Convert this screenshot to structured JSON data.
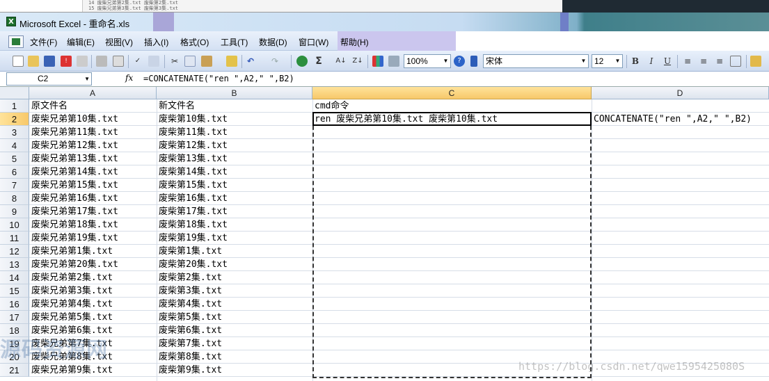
{
  "window": {
    "title": "Microsoft Excel - 重命名.xls",
    "app_icon": "excel-icon"
  },
  "background_window": {
    "lines": [
      "14  废柴兄弟第2集.txt       废柴第2集.txt",
      "15  废柴兄弟第3集.txt       废柴第3集.txt"
    ]
  },
  "menu": [
    "文件(F)",
    "编辑(E)",
    "视图(V)",
    "插入(I)",
    "格式(O)",
    "工具(T)",
    "数据(D)",
    "窗口(W)",
    "帮助(H)"
  ],
  "toolbar": {
    "zoom": "100%",
    "font_name": "宋体",
    "font_size": "12",
    "bold_label": "B",
    "italic_label": "I",
    "underline_label": "U"
  },
  "formula_bar": {
    "name_box": "C2",
    "fx_label": "fx",
    "formula": "=CONCATENATE(\"ren \",A2,\" \",B2)"
  },
  "columns": [
    "A",
    "B",
    "C",
    "D"
  ],
  "rows": [
    {
      "n": "1",
      "a": "原文件名",
      "b": "新文件名",
      "c": "cmd命令",
      "d": ""
    },
    {
      "n": "2",
      "a": "废柴兄弟第10集.txt",
      "b": "废柴第10集.txt",
      "c": "ren 废柴兄弟第10集.txt 废柴第10集.txt",
      "d": "CONCATENATE(\"ren \",A2,\" \",B2)"
    },
    {
      "n": "3",
      "a": "废柴兄弟第11集.txt",
      "b": "废柴第11集.txt",
      "c": "",
      "d": ""
    },
    {
      "n": "4",
      "a": "废柴兄弟第12集.txt",
      "b": "废柴第12集.txt",
      "c": "",
      "d": ""
    },
    {
      "n": "5",
      "a": "废柴兄弟第13集.txt",
      "b": "废柴第13集.txt",
      "c": "",
      "d": ""
    },
    {
      "n": "6",
      "a": "废柴兄弟第14集.txt",
      "b": "废柴第14集.txt",
      "c": "",
      "d": ""
    },
    {
      "n": "7",
      "a": "废柴兄弟第15集.txt",
      "b": "废柴第15集.txt",
      "c": "",
      "d": ""
    },
    {
      "n": "8",
      "a": "废柴兄弟第16集.txt",
      "b": "废柴第16集.txt",
      "c": "",
      "d": ""
    },
    {
      "n": "9",
      "a": "废柴兄弟第17集.txt",
      "b": "废柴第17集.txt",
      "c": "",
      "d": ""
    },
    {
      "n": "10",
      "a": "废柴兄弟第18集.txt",
      "b": "废柴第18集.txt",
      "c": "",
      "d": ""
    },
    {
      "n": "11",
      "a": "废柴兄弟第19集.txt",
      "b": "废柴第19集.txt",
      "c": "",
      "d": ""
    },
    {
      "n": "12",
      "a": "废柴兄弟第1集.txt",
      "b": "废柴第1集.txt",
      "c": "",
      "d": ""
    },
    {
      "n": "13",
      "a": "废柴兄弟第20集.txt",
      "b": "废柴第20集.txt",
      "c": "",
      "d": ""
    },
    {
      "n": "14",
      "a": "废柴兄弟第2集.txt",
      "b": "废柴第2集.txt",
      "c": "",
      "d": ""
    },
    {
      "n": "15",
      "a": "废柴兄弟第3集.txt",
      "b": "废柴第3集.txt",
      "c": "",
      "d": ""
    },
    {
      "n": "16",
      "a": "废柴兄弟第4集.txt",
      "b": "废柴第4集.txt",
      "c": "",
      "d": ""
    },
    {
      "n": "17",
      "a": "废柴兄弟第5集.txt",
      "b": "废柴第5集.txt",
      "c": "",
      "d": ""
    },
    {
      "n": "18",
      "a": "废柴兄弟第6集.txt",
      "b": "废柴第6集.txt",
      "c": "",
      "d": ""
    },
    {
      "n": "19",
      "a": "废柴兄弟第7集.txt",
      "b": "废柴第7集.txt",
      "c": "",
      "d": ""
    },
    {
      "n": "20",
      "a": "废柴兄弟第8集.txt",
      "b": "废柴第8集.txt",
      "c": "",
      "d": ""
    },
    {
      "n": "21",
      "a": "废柴兄弟第9集.txt",
      "b": "废柴第9集.txt",
      "c": "",
      "d": ""
    }
  ],
  "watermarks": {
    "site": "源码资源网",
    "url": "https://blog.csdn.net/qwe1595425080S"
  },
  "colors": {
    "selected_header": "#f7c86a",
    "title_gradient": "#c6dcf2",
    "excel_green": "#1d6f2c"
  }
}
